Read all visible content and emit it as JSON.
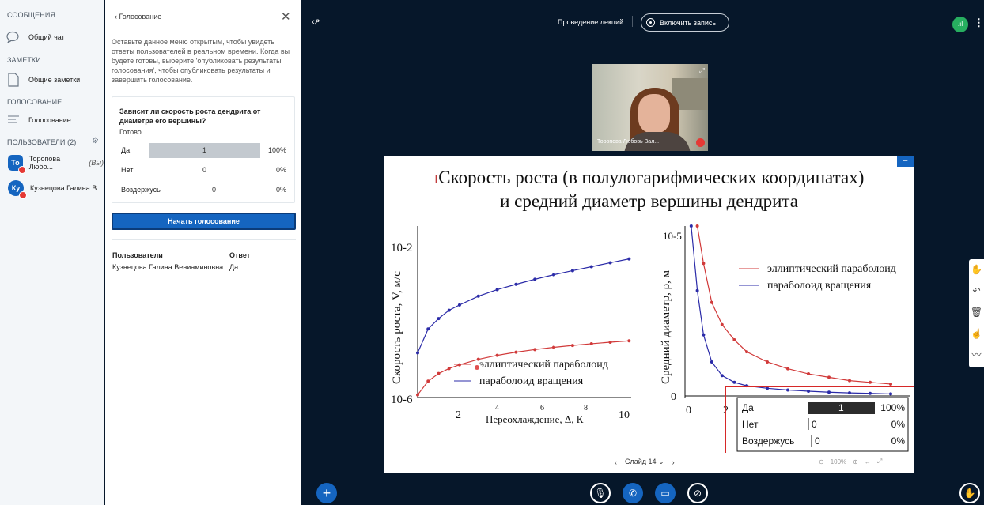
{
  "sidebar": {
    "messages_header": "СООБЩЕНИЯ",
    "public_chat": "Общий чат",
    "notes_header": "ЗАМЕТКИ",
    "shared_notes": "Общие заметки",
    "polling_header": "ГОЛОСОВАНИЕ",
    "polling_item": "Голосование",
    "users_header": "ПОЛЬЗОВАТЕЛИ (2)",
    "users": [
      {
        "initials": "То",
        "name": "Торопова Любо...",
        "you": "(Вы)"
      },
      {
        "initials": "Ку",
        "name": "Кузнецова Галина В..."
      }
    ]
  },
  "poll": {
    "back_label": "Голосование",
    "close_icon": "close-icon",
    "description": "Оставьте данное меню открытым, чтобы увидеть ответы пользователей в реальном времени. Когда вы будете готовы, выберите 'опубликовать результаты голосования', чтобы опубликовать результаты и завершить голосование.",
    "question": "Зависит ли скорость роста дендрита от диаметра его вершины?",
    "status": "Готово",
    "answers": [
      {
        "label": "Да",
        "count": "1",
        "percent": "100%",
        "fraction": 1.0
      },
      {
        "label": "Нет",
        "count": "0",
        "percent": "0%",
        "fraction": 0.0
      },
      {
        "label": "Воздержусь",
        "count": "0",
        "percent": "0%",
        "fraction": 0.0
      }
    ],
    "start_button": "Начать голосование",
    "results_headers": {
      "users": "Пользователи",
      "answer": "Ответ"
    },
    "results_rows": [
      {
        "user": "Кузнецова Галина Вениаминовна",
        "answer": "Да"
      }
    ]
  },
  "main": {
    "meeting_title": "Проведение лекций",
    "record_button": "Включить запись",
    "webcam_name": "Торопова Любовь Вал...",
    "slide": {
      "title_line1": "Скорость роста (в полулогарифмических координатах)",
      "title_line2": "и средний диаметр вершины дендрита",
      "page_label": "Слайд 14",
      "zoom": "100%"
    },
    "overlay": {
      "rows": [
        {
          "label": "Да",
          "count": "1",
          "percent": "100%"
        },
        {
          "label": "Нет",
          "count": "0",
          "percent": "0%"
        },
        {
          "label": "Воздержусь",
          "count": "0",
          "percent": "0%"
        }
      ]
    }
  },
  "chart_data": [
    {
      "type": "line",
      "xlabel": "Переохлаждение, Δ, К",
      "ylabel": "Скорость роста, V, м/с",
      "ytick_labels": [
        "10-6",
        "10-2"
      ],
      "xtick_labels": [
        "2",
        "4",
        "6",
        "8",
        "10"
      ],
      "xlim": [
        0.3,
        10.5
      ],
      "log_y": true,
      "legend_placement": "bottom-center",
      "series": [
        {
          "name": "эллиптический параболоид",
          "color": "#d13a3a",
          "x": [
            0.3,
            0.8,
            1.3,
            1.8,
            2.3,
            3.2,
            4.1,
            5.0,
            5.9,
            6.8,
            7.7,
            8.6,
            9.5,
            10.4
          ],
          "y": [
            1.2e-06,
            3e-06,
            5e-06,
            7e-06,
            9e-06,
            1.3e-05,
            1.7e-05,
            2.1e-05,
            2.5e-05,
            2.9e-05,
            3.3e-05,
            3.7e-05,
            4.1e-05,
            4.5e-05
          ]
        },
        {
          "name": "параболоид вращения",
          "color": "#2b2ba8",
          "x": [
            0.3,
            0.8,
            1.3,
            1.8,
            2.3,
            3.2,
            4.1,
            5.0,
            5.9,
            6.8,
            7.7,
            8.6,
            9.5,
            10.4
          ],
          "y": [
            2e-05,
            0.0001,
            0.0002,
            0.00035,
            0.0005,
            0.0009,
            0.0014,
            0.002,
            0.0028,
            0.0038,
            0.005,
            0.0065,
            0.0085,
            0.011
          ]
        }
      ]
    },
    {
      "type": "line",
      "ylabel": "Средний диаметр, ρ, м",
      "ytick_labels": [
        "0",
        "10-5"
      ],
      "xtick_labels": [
        "0",
        "2"
      ],
      "legend_placement": "top-right",
      "series": [
        {
          "name": "эллиптический параболоид",
          "color": "#d13a3a",
          "x": [
            0.6,
            0.9,
            1.3,
            1.8,
            2.4,
            3.0,
            4.0,
            5.0,
            6.0,
            7.0,
            8.0,
            9.0,
            10.0
          ],
          "y": [
            1.0,
            0.78,
            0.55,
            0.42,
            0.33,
            0.26,
            0.2,
            0.16,
            0.13,
            0.11,
            0.09,
            0.08,
            0.07
          ]
        },
        {
          "name": "параболоид вращения",
          "color": "#2b2ba8",
          "x": [
            0.3,
            0.6,
            0.9,
            1.3,
            1.8,
            2.4,
            3.0,
            4.0,
            5.0,
            6.0,
            7.0,
            8.0,
            9.0,
            10.0
          ],
          "y": [
            1.0,
            0.62,
            0.36,
            0.2,
            0.12,
            0.08,
            0.06,
            0.045,
            0.035,
            0.028,
            0.022,
            0.018,
            0.015,
            0.012
          ]
        }
      ]
    }
  ]
}
